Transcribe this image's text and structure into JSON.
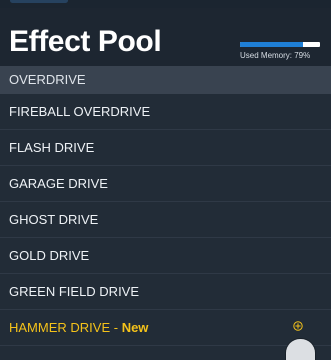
{
  "header": {
    "title": "Effect Pool",
    "memory_label": "Used Memory: 79%",
    "memory_used_fraction": 0.79,
    "memory_color": "#1f7fd6"
  },
  "section": {
    "label": "OVERDRIVE"
  },
  "effects": [
    {
      "name": "FIREBALL OVERDRIVE"
    },
    {
      "name": "FLASH DRIVE"
    },
    {
      "name": "GARAGE DRIVE"
    },
    {
      "name": "GHOST DRIVE"
    },
    {
      "name": "GOLD DRIVE"
    },
    {
      "name": "GREEN FIELD DRIVE"
    },
    {
      "name": "HAMMER DRIVE",
      "separator": " - ",
      "badge": "New",
      "is_new": true,
      "action_icon": "add-circle-icon"
    }
  ],
  "colors": {
    "background": "#222c37",
    "section_header": "#394350",
    "new_item_accent": "#f4c21a"
  }
}
